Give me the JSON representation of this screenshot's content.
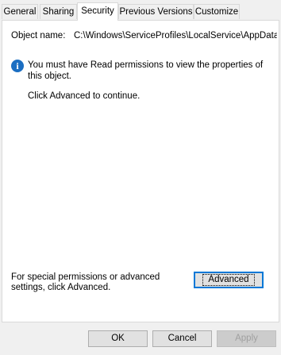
{
  "tabs": [
    {
      "label": "General",
      "active": false
    },
    {
      "label": "Sharing",
      "active": false
    },
    {
      "label": "Security",
      "active": true
    },
    {
      "label": "Previous Versions",
      "active": false
    },
    {
      "label": "Customize",
      "active": false
    }
  ],
  "security": {
    "object_name_label": "Object name:",
    "object_name_value": "C:\\Windows\\ServiceProfiles\\LocalService\\AppData",
    "info_icon": "info-icon",
    "permission_message": "You must have Read permissions to view the properties of this object.",
    "continue_message": "Click Advanced to continue.",
    "special_permissions_text": "For special permissions or advanced settings, click Advanced.",
    "advanced_button": "Advanced"
  },
  "footer": {
    "ok_label": "OK",
    "cancel_label": "Cancel",
    "apply_label": "Apply",
    "apply_disabled": true
  },
  "colors": {
    "dialog_background": "#f0f0f0",
    "panel_background": "#ffffff",
    "info_icon": "#1b6ec2",
    "focus_border": "#0078d7",
    "disabled_text": "#a0a0a0"
  }
}
